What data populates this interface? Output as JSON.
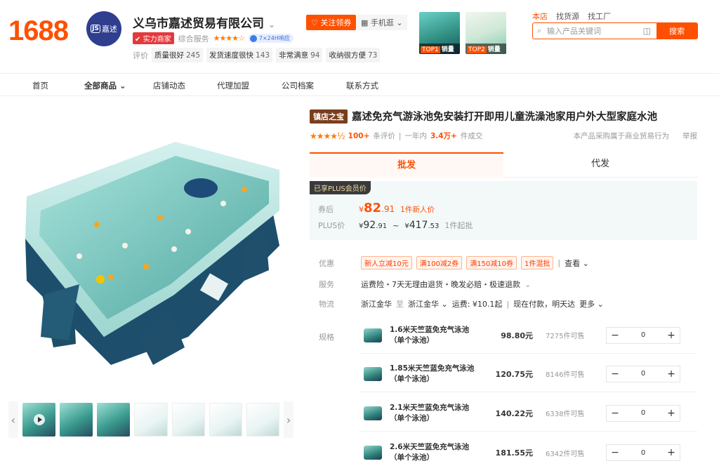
{
  "brand": {
    "logo": "1688"
  },
  "shop": {
    "avatar_text": "嘉述",
    "avatar_mark": "JS",
    "name": "义乌市嘉述贸易有限公司",
    "strength_badge": "实力商家",
    "service_label": "综合服务",
    "rating_stars": "★★★★☆",
    "pill": "7×24H响应",
    "eval_label": "评价",
    "metrics": [
      {
        "label": "质量很好",
        "value": "245"
      },
      {
        "label": "发货速度很快",
        "value": "143"
      },
      {
        "label": "非常满意",
        "value": "94"
      },
      {
        "label": "收纳很方便",
        "value": "73"
      }
    ],
    "follow_button": "关注领券",
    "mobile_button": "手机逛"
  },
  "top_products": [
    {
      "tag": "TOP1",
      "label": "销量"
    },
    {
      "tag": "TOP2",
      "label": "销量"
    }
  ],
  "search": {
    "scopes": [
      "本店",
      "找货源",
      "找工厂"
    ],
    "placeholder": "输入产品关键词",
    "button": "搜索"
  },
  "nav": [
    "首页",
    "全部商品",
    "店铺动态",
    "代理加盟",
    "公司档案",
    "联系方式"
  ],
  "product": {
    "tag": "镇店之宝",
    "title": "嘉述免充气游泳池免安装打开即用儿童洗澡池家用户外大型家庭水池",
    "stars": "★★★★½",
    "reviews_count": "100+",
    "reviews_label": "条评价",
    "sales_period": "一年内",
    "sales_count": "3.4万+",
    "sales_label": "件成交",
    "notice": "本产品采购属于商业贸易行为",
    "report": "举报"
  },
  "tabs": [
    "批发",
    "代发"
  ],
  "price": {
    "plus_tag": "已享PLUS会员价",
    "coupon_label": "券后",
    "coupon_int": "82",
    "coupon_dec": ".91",
    "coupon_note": "1件新人价",
    "plus_label": "PLUS价",
    "low_int": "92",
    "low_dec": ".91",
    "tilde": "~",
    "high_int": "417",
    "high_dec": ".53",
    "moq": "1件起批",
    "currency": "¥"
  },
  "offers": {
    "label": "优惠",
    "coupons": [
      "新人立减10元",
      "满100减2券",
      "满150减10券",
      "1件混批"
    ],
    "more": "查看"
  },
  "service": {
    "label": "服务",
    "text": "运费险・7天无理由退货・晚发必赔・极速退款"
  },
  "logistics": {
    "label": "物流",
    "from": "浙江金华",
    "to_label": "至",
    "to": "浙江金华",
    "fee": "运费: ¥10.1起",
    "delivery": "现在付款，明天达",
    "more": "更多"
  },
  "spec_label": "规格",
  "skus": [
    {
      "name": "1.6米天竺蓝免充气泳池（单个泳池）",
      "price": "98.80元",
      "stock": "7275件可售",
      "qty": "0"
    },
    {
      "name": "1.85米天竺蓝免充气泳池（单个泳池）",
      "price": "120.75元",
      "stock": "8146件可售",
      "qty": "0"
    },
    {
      "name": "2.1米天竺蓝免充气泳池（单个泳池）",
      "price": "140.22元",
      "stock": "6338件可售",
      "qty": "0"
    },
    {
      "name": "2.6米天竺蓝免充气泳池（单个泳池）",
      "price": "181.55元",
      "stock": "6342件可售",
      "qty": "0"
    }
  ],
  "colors": {
    "accent": "#ff5000",
    "tag_brown": "#7a3e1d",
    "pool_teal": "#2e8c7e",
    "pool_navy": "#1d3e52"
  }
}
